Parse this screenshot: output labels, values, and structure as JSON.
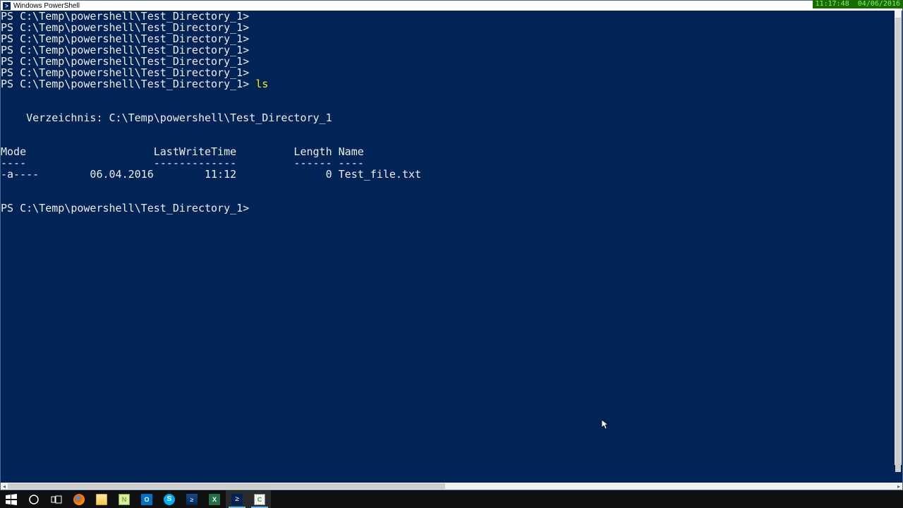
{
  "clock": {
    "time": "11:17:48",
    "date": "04/06/2016"
  },
  "window": {
    "title": "Windows PowerShell"
  },
  "terminal": {
    "prompt": "PS C:\\Temp\\powershell\\Test_Directory_1>",
    "blank_prompts": 6,
    "command": "ls",
    "output": {
      "dir_label": "Verzeichnis: C:\\Temp\\powershell\\Test_Directory_1",
      "headers": {
        "mode": "Mode",
        "lastwrite": "LastWriteTime",
        "length": "Length",
        "name": "Name"
      },
      "dividers": {
        "mode": "----",
        "lastwrite": "-------------",
        "length": "------",
        "name": "----"
      },
      "rows": [
        {
          "mode": "-a----",
          "date": "06.04.2016",
          "time": "11:12",
          "length": "0",
          "name": "Test_file.txt"
        }
      ]
    }
  },
  "taskbar": {
    "items": [
      {
        "name": "start",
        "icon": "windows-icon"
      },
      {
        "name": "cortana",
        "icon": "circle-icon"
      },
      {
        "name": "taskview",
        "icon": "taskview-icon"
      },
      {
        "name": "firefox",
        "icon": "firefox-icon"
      },
      {
        "name": "explorer",
        "icon": "folder-icon"
      },
      {
        "name": "notepadpp",
        "icon": "notepadpp-icon"
      },
      {
        "name": "outlook",
        "icon": "outlook-icon"
      },
      {
        "name": "skype",
        "icon": "skype-icon"
      },
      {
        "name": "ise",
        "icon": "ise-icon"
      },
      {
        "name": "excel",
        "icon": "excel-icon"
      },
      {
        "name": "powershell",
        "icon": "powershell-icon",
        "active": true
      },
      {
        "name": "camtasia",
        "icon": "camtasia-icon",
        "active": true
      }
    ]
  }
}
